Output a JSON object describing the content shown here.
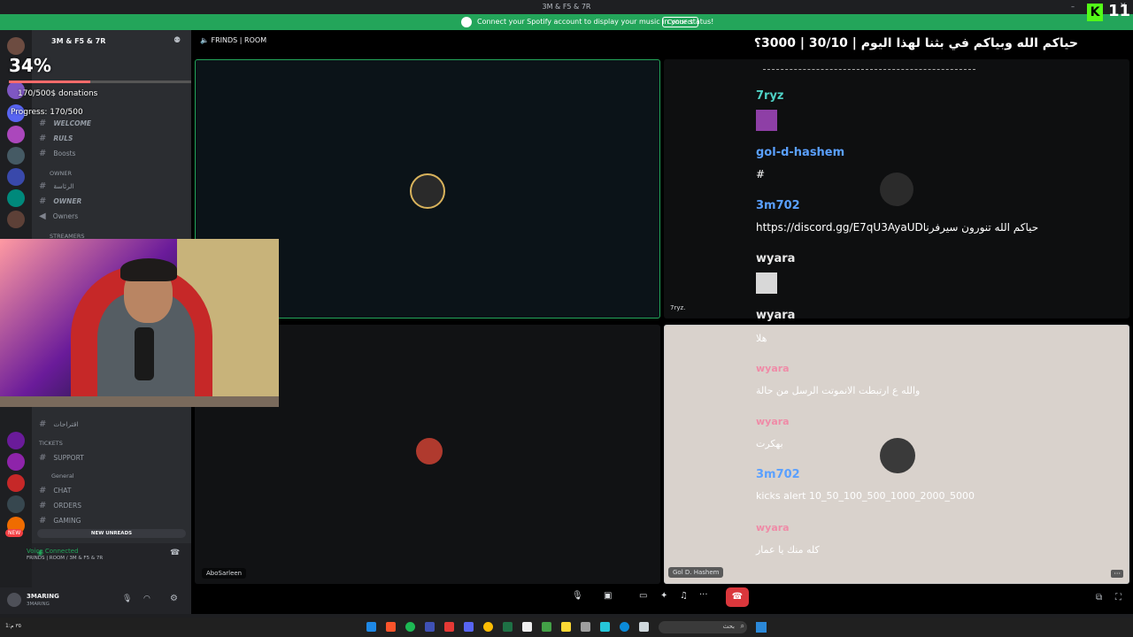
{
  "window": {
    "title": "3M & F5 & 7R"
  },
  "spotify_banner": {
    "text": "Connect your Spotify account to display your music in your status!",
    "button": "Connect"
  },
  "overlay": {
    "percent": "34%",
    "donations": "170/500$ donations",
    "progress_label": "Progress: 170/500",
    "progress_fraction": 0.34,
    "kick_badge": "11"
  },
  "server": {
    "name": "3M & F5 & 7R"
  },
  "sidebar": {
    "channels_top": [
      {
        "label": "WELCOME"
      },
      {
        "label": "RULS"
      },
      {
        "label": "Boosts"
      }
    ],
    "category_owner": "owner",
    "owner_channels": [
      {
        "label": "الرئاسة"
      },
      {
        "label": "OWNER"
      },
      {
        "label": "Owners"
      }
    ],
    "category_streamers": "STREAMERS",
    "lower_channels": [
      {
        "label": "اقتراحات"
      }
    ],
    "category_tickets": "TICKETS",
    "tickets_channels": [
      {
        "label": "SUPPORT"
      }
    ],
    "category_general": "General",
    "general_channels": [
      {
        "label": "CHAT"
      },
      {
        "label": "ORDERS"
      },
      {
        "label": "GAMING"
      }
    ],
    "new_unreads": "NEW UNREADS",
    "new_badge": "NEW"
  },
  "voice": {
    "status": "Voice Connected",
    "room": "FRINDS | ROOM / 3M & F5 & 7R"
  },
  "user": {
    "name": "3MARING",
    "sub": "3MARING"
  },
  "stage_header": {
    "room": "FRINDS | ROOM",
    "announcement": "حياكم الله وبياكم في بثنا لهذا اليوم | 30/10 | 3000؟"
  },
  "tiles": {
    "top_left_label": "",
    "bottom_left_label": "AboSarleen",
    "bottom_right_label": "Gol D. Hashem",
    "top_right_label": "7ryz."
  },
  "chat": [
    {
      "user": "7ryz",
      "color": "#4fd1c5",
      "text": ""
    },
    {
      "user": "gol-d-hashem",
      "color": "#5aa0ff",
      "text": "#"
    },
    {
      "user": "3m702",
      "color": "#5aa0ff",
      "text": "https://discord.gg/E7qU3AyaUDحياكم الله تنورون سيرفرنا"
    },
    {
      "user": "wyara",
      "color": "#e8e8e8",
      "text": ""
    },
    {
      "user": "wyara",
      "color": "#e8e8e8",
      "text": "هلا"
    },
    {
      "user": "wyara",
      "color": "#ff5d8f",
      "text": "والله ع ارتبطت الانموتت الرسل من حالة"
    },
    {
      "user": "wyara",
      "color": "#ff5d8f",
      "text": "بهكرت"
    },
    {
      "user": "3m702",
      "color": "#5aa0ff",
      "text": "kicks alert 10_50_100_500_1000_2000_5000"
    },
    {
      "user": "wyara",
      "color": "#ff5d8f",
      "text": "كله منك يا عمار"
    }
  ],
  "taskbar": {
    "search": "بحث",
    "time": "1:٣٥ م"
  }
}
